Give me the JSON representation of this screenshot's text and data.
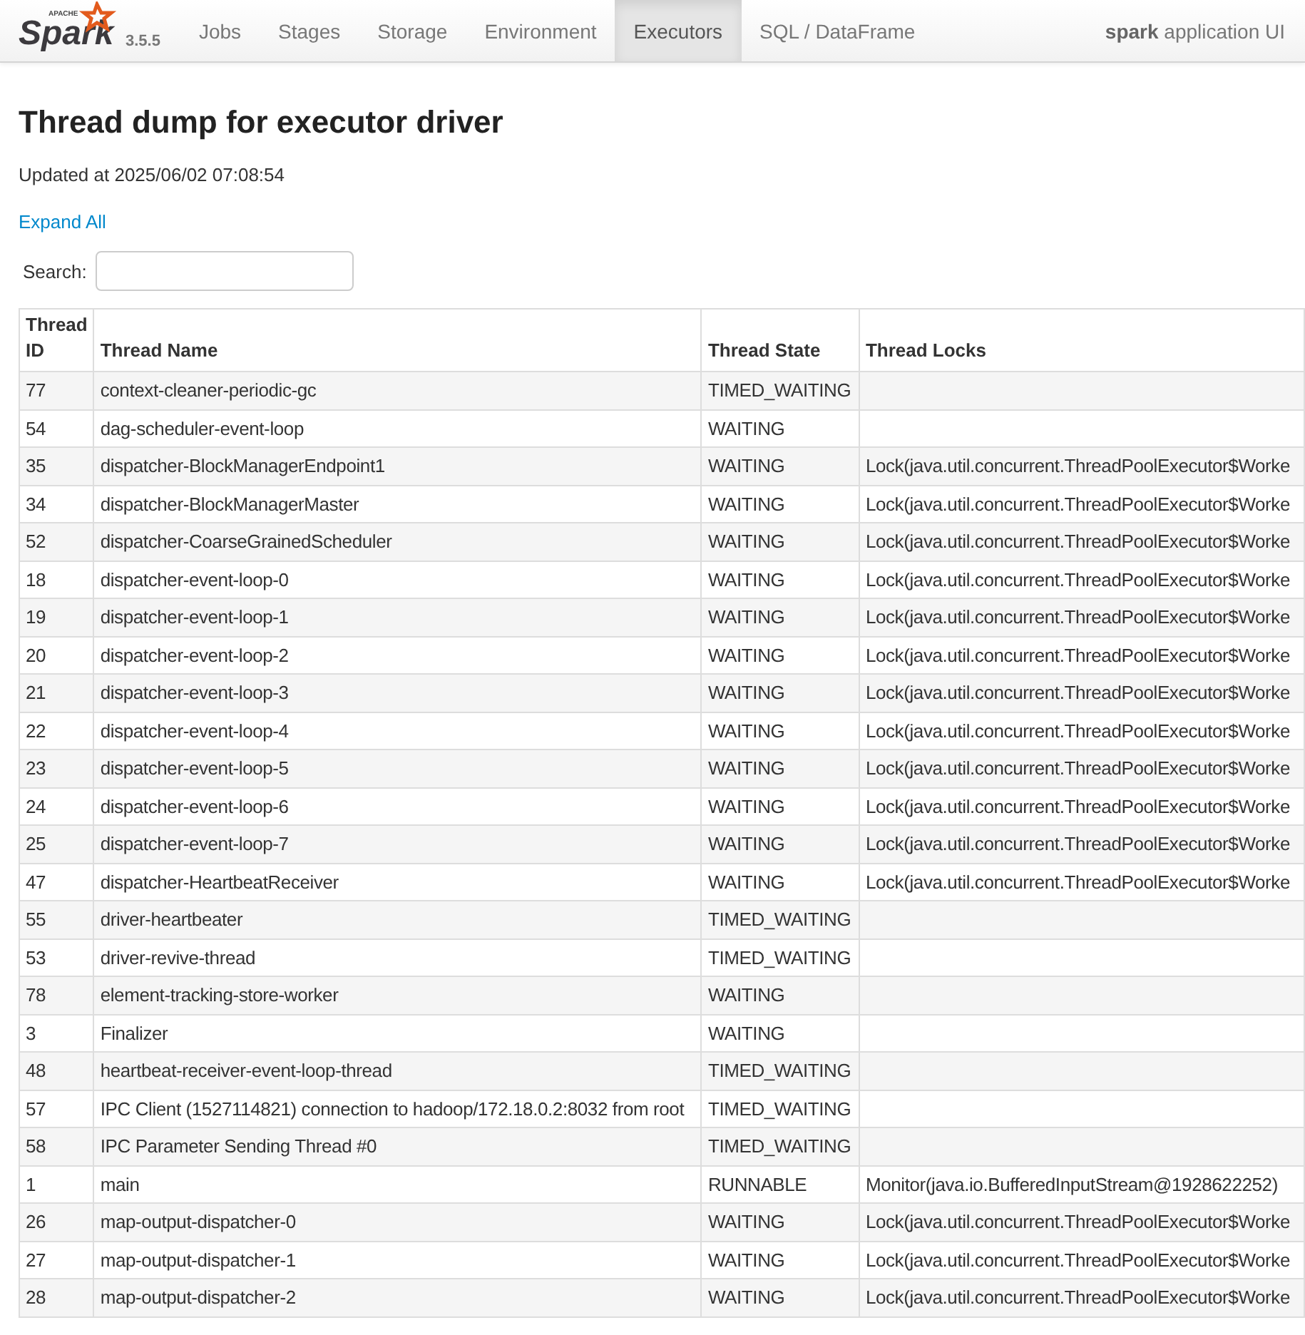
{
  "navbar": {
    "logo": {
      "small": "APACHE",
      "word": "Spark"
    },
    "version": "3.5.5",
    "tabs": [
      {
        "label": "Jobs",
        "selected": false
      },
      {
        "label": "Stages",
        "selected": false
      },
      {
        "label": "Storage",
        "selected": false
      },
      {
        "label": "Environment",
        "selected": false
      },
      {
        "label": "Executors",
        "selected": true
      },
      {
        "label": "SQL / DataFrame",
        "selected": false
      }
    ],
    "app_name": {
      "name": "spark",
      "suffix": "application UI"
    }
  },
  "title": "Thread dump for executor driver",
  "updated": "Updated at 2025/06/02 07:08:54",
  "expand_link": "Expand All",
  "search": {
    "label": "Search:"
  },
  "table": {
    "columns": [
      "Thread ID",
      "Thread Name",
      "Thread State",
      "Thread Locks"
    ],
    "rows": [
      [
        "77",
        "context-cleaner-periodic-gc",
        "TIMED_WAITING",
        ""
      ],
      [
        "54",
        "dag-scheduler-event-loop",
        "WAITING",
        ""
      ],
      [
        "35",
        "dispatcher-BlockManagerEndpoint1",
        "WAITING",
        "Lock(java.util.concurrent.ThreadPoolExecutor$Worke"
      ],
      [
        "34",
        "dispatcher-BlockManagerMaster",
        "WAITING",
        "Lock(java.util.concurrent.ThreadPoolExecutor$Worke"
      ],
      [
        "52",
        "dispatcher-CoarseGrainedScheduler",
        "WAITING",
        "Lock(java.util.concurrent.ThreadPoolExecutor$Worke"
      ],
      [
        "18",
        "dispatcher-event-loop-0",
        "WAITING",
        "Lock(java.util.concurrent.ThreadPoolExecutor$Worke"
      ],
      [
        "19",
        "dispatcher-event-loop-1",
        "WAITING",
        "Lock(java.util.concurrent.ThreadPoolExecutor$Worke"
      ],
      [
        "20",
        "dispatcher-event-loop-2",
        "WAITING",
        "Lock(java.util.concurrent.ThreadPoolExecutor$Worke"
      ],
      [
        "21",
        "dispatcher-event-loop-3",
        "WAITING",
        "Lock(java.util.concurrent.ThreadPoolExecutor$Worke"
      ],
      [
        "22",
        "dispatcher-event-loop-4",
        "WAITING",
        "Lock(java.util.concurrent.ThreadPoolExecutor$Worke"
      ],
      [
        "23",
        "dispatcher-event-loop-5",
        "WAITING",
        "Lock(java.util.concurrent.ThreadPoolExecutor$Worke"
      ],
      [
        "24",
        "dispatcher-event-loop-6",
        "WAITING",
        "Lock(java.util.concurrent.ThreadPoolExecutor$Worke"
      ],
      [
        "25",
        "dispatcher-event-loop-7",
        "WAITING",
        "Lock(java.util.concurrent.ThreadPoolExecutor$Worke"
      ],
      [
        "47",
        "dispatcher-HeartbeatReceiver",
        "WAITING",
        "Lock(java.util.concurrent.ThreadPoolExecutor$Worke"
      ],
      [
        "55",
        "driver-heartbeater",
        "TIMED_WAITING",
        ""
      ],
      [
        "53",
        "driver-revive-thread",
        "TIMED_WAITING",
        ""
      ],
      [
        "78",
        "element-tracking-store-worker",
        "WAITING",
        ""
      ],
      [
        "3",
        "Finalizer",
        "WAITING",
        ""
      ],
      [
        "48",
        "heartbeat-receiver-event-loop-thread",
        "TIMED_WAITING",
        ""
      ],
      [
        "57",
        "IPC Client (1527114821) connection to hadoop/172.18.0.2:8032 from root",
        "TIMED_WAITING",
        ""
      ],
      [
        "58",
        "IPC Parameter Sending Thread #0",
        "TIMED_WAITING",
        ""
      ],
      [
        "1",
        "main",
        "RUNNABLE",
        "Monitor(java.io.BufferedInputStream@1928622252)"
      ],
      [
        "26",
        "map-output-dispatcher-0",
        "WAITING",
        "Lock(java.util.concurrent.ThreadPoolExecutor$Worke"
      ],
      [
        "27",
        "map-output-dispatcher-1",
        "WAITING",
        "Lock(java.util.concurrent.ThreadPoolExecutor$Worke"
      ],
      [
        "28",
        "map-output-dispatcher-2",
        "WAITING",
        "Lock(java.util.concurrent.ThreadPoolExecutor$Worke"
      ]
    ]
  }
}
